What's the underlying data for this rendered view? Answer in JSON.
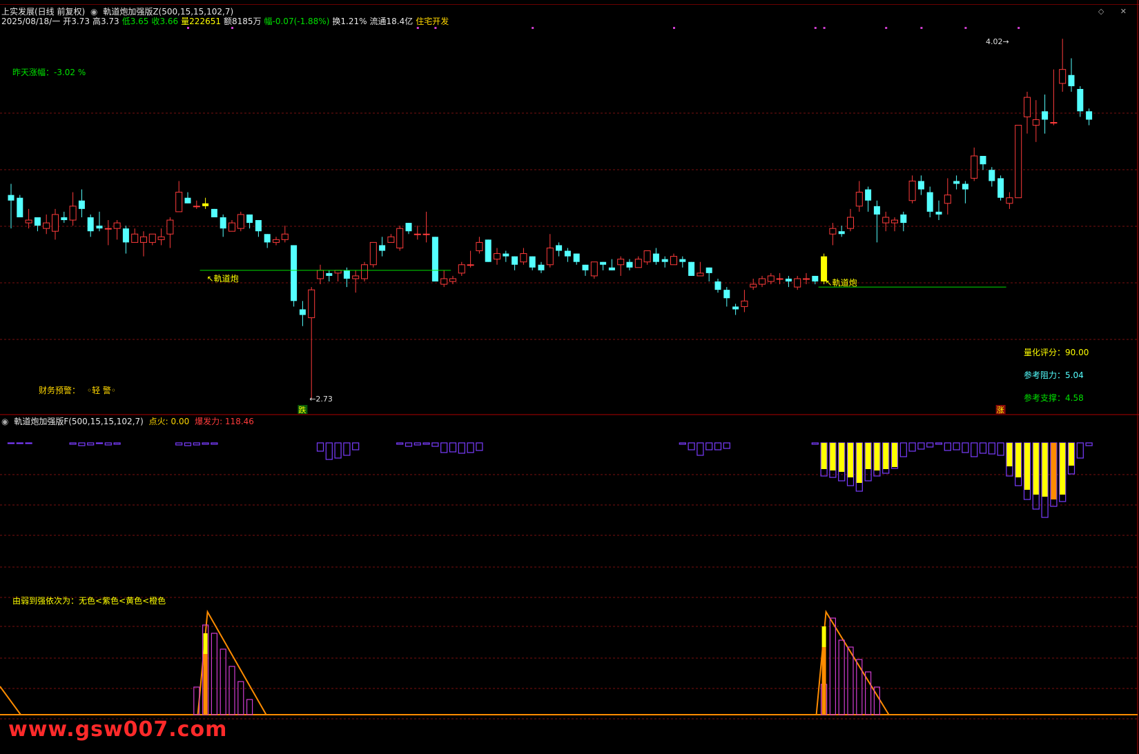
{
  "header": {
    "stock": "上实发展(日线 前复权)",
    "indicator": "軌道炮加强版Z(500,15,15,102,7)",
    "date": "2025/08/18/一",
    "open_label": "开",
    "open": "3.73",
    "high_label": "高",
    "high": "3.73",
    "low_label": "低",
    "low": "3.65",
    "close_label": "收",
    "close": "3.66",
    "vol_label": "量",
    "vol": "222651",
    "amount": "额8185万",
    "change": "幅-0.07(-1.88%)",
    "turnover": "换1.21%",
    "float": "流通18.4亿",
    "sector": "住宅开发"
  },
  "window_icons": "◇ ✕",
  "main": {
    "yesterday_label": "昨天涨幅：-3.02 %",
    "finance_warning": "财务预警：",
    "finance_level": "◦轻 警◦",
    "score": "量化评分：90.00",
    "resistance": "参考阻力：5.04",
    "support": "参考支撑：4.58",
    "signal_label_1": "↖軌道炮",
    "signal_label_2": "↖軌道炮",
    "high_marker": "4.02",
    "low_marker": "2.73",
    "bottom_tag_1": "跌",
    "bottom_tag_2": "涨"
  },
  "sub": {
    "indicator": "軌道炮加强版F(500,15,15,102,7)",
    "ignite": "点火: 0.00",
    "burst": "爆发力: 118.46",
    "legend": "由弱到强依次为：无色<紫色<黄色<橙色"
  },
  "watermark": "www.gsw007.com",
  "colors": {
    "up": "#ff3b3b",
    "down": "#54ffff",
    "purple": "#7a3cff",
    "yellow": "#ffff00",
    "orange": "#ff8c00",
    "green": "#00e000",
    "grid": "#7a1010"
  },
  "chart_data": {
    "type": "candlestick",
    "high_label": "4.02",
    "low_label": "2.73",
    "candles": [
      [
        3.46,
        3.44,
        3.5,
        3.34
      ],
      [
        3.45,
        3.38,
        3.46,
        3.38
      ],
      [
        3.36,
        3.37,
        3.41,
        3.34
      ],
      [
        3.38,
        3.35,
        3.38,
        3.33
      ],
      [
        3.34,
        3.36,
        3.39,
        3.32
      ],
      [
        3.33,
        3.39,
        3.41,
        3.3
      ],
      [
        3.38,
        3.37,
        3.4,
        3.36
      ],
      [
        3.37,
        3.42,
        3.47,
        3.35
      ],
      [
        3.44,
        3.41,
        3.48,
        3.38
      ],
      [
        3.38,
        3.33,
        3.39,
        3.31
      ],
      [
        3.35,
        3.34,
        3.4,
        3.33
      ],
      [
        3.34,
        3.34,
        3.37,
        3.28
      ],
      [
        3.34,
        3.36,
        3.37,
        3.3
      ],
      [
        3.34,
        3.29,
        3.35,
        3.25
      ],
      [
        3.29,
        3.32,
        3.34,
        3.29
      ],
      [
        3.29,
        3.31,
        3.33,
        3.24
      ],
      [
        3.29,
        3.32,
        3.32,
        3.28
      ],
      [
        3.3,
        3.31,
        3.34,
        3.28
      ],
      [
        3.32,
        3.37,
        3.38,
        3.27
      ],
      [
        3.4,
        3.47,
        3.51,
        3.4
      ],
      [
        3.45,
        3.43,
        3.47,
        3.43
      ],
      [
        3.42,
        3.42,
        3.44,
        3.41
      ],
      [
        3.43,
        3.42,
        3.45,
        3.41
      ],
      [
        3.41,
        3.38,
        3.41,
        3.38
      ],
      [
        3.38,
        3.34,
        3.39,
        3.31
      ],
      [
        3.33,
        3.36,
        3.37,
        3.33
      ],
      [
        3.34,
        3.39,
        3.4,
        3.33
      ],
      [
        3.39,
        3.36,
        3.39,
        3.34
      ],
      [
        3.37,
        3.33,
        3.37,
        3.31
      ],
      [
        3.32,
        3.29,
        3.32,
        3.27
      ],
      [
        3.29,
        3.3,
        3.31,
        3.28
      ],
      [
        3.3,
        3.32,
        3.35,
        3.29
      ],
      [
        3.28,
        3.08,
        3.28,
        3.06
      ],
      [
        3.05,
        3.03,
        3.08,
        2.99
      ],
      [
        3.02,
        3.12,
        3.13,
        2.73
      ],
      [
        3.16,
        3.19,
        3.21,
        3.14
      ],
      [
        3.18,
        3.17,
        3.19,
        3.15
      ],
      [
        3.18,
        3.19,
        3.19,
        3.15
      ],
      [
        3.19,
        3.16,
        3.2,
        3.13
      ],
      [
        3.16,
        3.17,
        3.19,
        3.11
      ],
      [
        3.16,
        3.21,
        3.22,
        3.15
      ],
      [
        3.21,
        3.29,
        3.29,
        3.2
      ],
      [
        3.28,
        3.26,
        3.31,
        3.24
      ],
      [
        3.29,
        3.31,
        3.32,
        3.29
      ],
      [
        3.27,
        3.34,
        3.35,
        3.26
      ],
      [
        3.36,
        3.33,
        3.36,
        3.32
      ],
      [
        3.32,
        3.32,
        3.35,
        3.3
      ],
      [
        3.32,
        3.32,
        3.4,
        3.29
      ],
      [
        3.31,
        3.15,
        3.31,
        3.15
      ],
      [
        3.14,
        3.16,
        3.19,
        3.13
      ],
      [
        3.15,
        3.16,
        3.17,
        3.14
      ],
      [
        3.18,
        3.21,
        3.22,
        3.17
      ],
      [
        3.21,
        3.21,
        3.26,
        3.2
      ],
      [
        3.26,
        3.29,
        3.31,
        3.25
      ],
      [
        3.3,
        3.22,
        3.3,
        3.22
      ],
      [
        3.23,
        3.25,
        3.27,
        3.21
      ],
      [
        3.25,
        3.24,
        3.26,
        3.22
      ],
      [
        3.24,
        3.21,
        3.24,
        3.19
      ],
      [
        3.22,
        3.25,
        3.27,
        3.21
      ],
      [
        3.24,
        3.2,
        3.24,
        3.19
      ],
      [
        3.21,
        3.19,
        3.22,
        3.18
      ],
      [
        3.21,
        3.27,
        3.32,
        3.2
      ],
      [
        3.28,
        3.26,
        3.29,
        3.24
      ],
      [
        3.26,
        3.24,
        3.27,
        3.22
      ],
      [
        3.25,
        3.22,
        3.25,
        3.21
      ],
      [
        3.21,
        3.19,
        3.21,
        3.17
      ],
      [
        3.17,
        3.22,
        3.22,
        3.16
      ],
      [
        3.22,
        3.21,
        3.22,
        3.19
      ],
      [
        3.2,
        3.19,
        3.23,
        3.19
      ],
      [
        3.21,
        3.23,
        3.24,
        3.17
      ],
      [
        3.22,
        3.2,
        3.23,
        3.19
      ],
      [
        3.2,
        3.23,
        3.24,
        3.2
      ],
      [
        3.22,
        3.26,
        3.26,
        3.21
      ],
      [
        3.25,
        3.22,
        3.27,
        3.21
      ],
      [
        3.23,
        3.22,
        3.24,
        3.2
      ],
      [
        3.21,
        3.24,
        3.25,
        3.21
      ],
      [
        3.23,
        3.22,
        3.24,
        3.2
      ],
      [
        3.22,
        3.17,
        3.22,
        3.17
      ],
      [
        3.17,
        3.18,
        3.22,
        3.17
      ],
      [
        3.2,
        3.18,
        3.2,
        3.15
      ],
      [
        3.15,
        3.12,
        3.16,
        3.11
      ],
      [
        3.12,
        3.09,
        3.13,
        3.06
      ],
      [
        3.06,
        3.05,
        3.07,
        3.03
      ],
      [
        3.06,
        3.08,
        3.12,
        3.04
      ],
      [
        3.13,
        3.14,
        3.16,
        3.12
      ],
      [
        3.14,
        3.16,
        3.17,
        3.13
      ],
      [
        3.15,
        3.17,
        3.18,
        3.14
      ],
      [
        3.16,
        3.16,
        3.18,
        3.14
      ],
      [
        3.16,
        3.15,
        3.17,
        3.13
      ],
      [
        3.13,
        3.16,
        3.17,
        3.12
      ],
      [
        3.16,
        3.16,
        3.18,
        3.14
      ],
      [
        3.17,
        3.15,
        3.17,
        3.14
      ],
      [
        3.15,
        3.24,
        3.25,
        3.14
      ],
      [
        3.32,
        3.34,
        3.36,
        3.28
      ],
      [
        3.33,
        3.32,
        3.35,
        3.31
      ],
      [
        3.34,
        3.38,
        3.41,
        3.33
      ],
      [
        3.42,
        3.47,
        3.51,
        3.4
      ],
      [
        3.48,
        3.44,
        3.49,
        3.4
      ],
      [
        3.42,
        3.39,
        3.44,
        3.29
      ],
      [
        3.36,
        3.38,
        3.4,
        3.33
      ],
      [
        3.36,
        3.37,
        3.38,
        3.33
      ],
      [
        3.39,
        3.36,
        3.4,
        3.33
      ],
      [
        3.44,
        3.51,
        3.53,
        3.43
      ],
      [
        3.51,
        3.48,
        3.53,
        3.46
      ],
      [
        3.47,
        3.4,
        3.49,
        3.38
      ],
      [
        3.4,
        3.39,
        3.44,
        3.37
      ],
      [
        3.43,
        3.46,
        3.52,
        3.39
      ],
      [
        3.51,
        3.5,
        3.53,
        3.48
      ],
      [
        3.5,
        3.48,
        3.51,
        3.43
      ],
      [
        3.52,
        3.6,
        3.63,
        3.51
      ],
      [
        3.6,
        3.57,
        3.59,
        3.55
      ],
      [
        3.55,
        3.51,
        3.56,
        3.49
      ],
      [
        3.52,
        3.45,
        3.53,
        3.44
      ],
      [
        3.43,
        3.45,
        3.47,
        3.41
      ],
      [
        3.45,
        3.71,
        3.71,
        3.45
      ],
      [
        3.74,
        3.81,
        3.83,
        3.68
      ],
      [
        3.71,
        3.73,
        3.8,
        3.65
      ],
      [
        3.76,
        3.73,
        3.82,
        3.68
      ],
      [
        3.72,
        3.72,
        3.91,
        3.71
      ],
      [
        3.86,
        3.91,
        4.02,
        3.83
      ],
      [
        3.89,
        3.85,
        3.95,
        3.83
      ],
      [
        3.84,
        3.76,
        3.85,
        3.74
      ],
      [
        3.76,
        3.73,
        3.77,
        3.71
      ]
    ],
    "signal_candles": [
      22,
      92
    ],
    "ignite_value": 0.0,
    "burst_value": 118.46
  }
}
